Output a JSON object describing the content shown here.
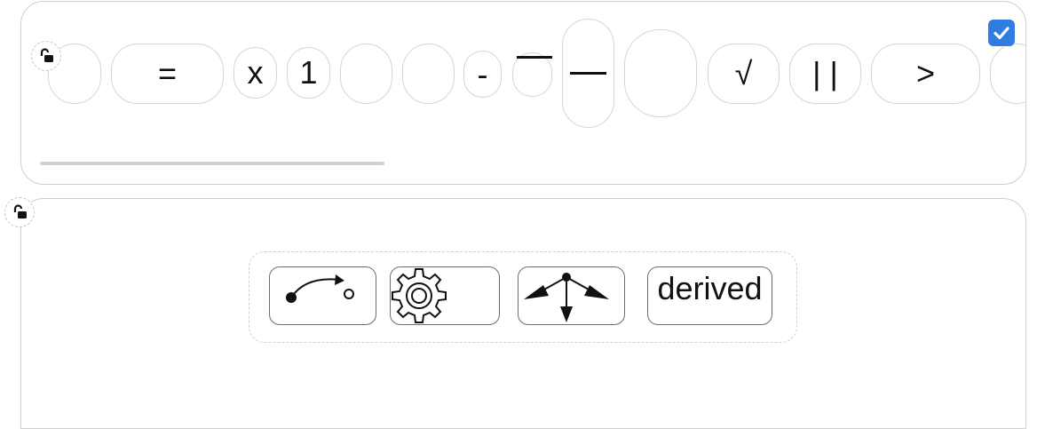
{
  "palette": {
    "tiles": [
      {
        "id": "tile-blank-1",
        "label": ""
      },
      {
        "id": "tile-equals",
        "label": "="
      },
      {
        "id": "tile-variable-x",
        "label": "x"
      },
      {
        "id": "tile-number-1",
        "label": "1"
      },
      {
        "id": "tile-blank-2",
        "label": ""
      },
      {
        "id": "tile-blank-3",
        "label": ""
      },
      {
        "id": "tile-minus",
        "label": "-"
      },
      {
        "id": "tile-overline",
        "label": ""
      },
      {
        "id": "tile-fraction",
        "label": ""
      },
      {
        "id": "tile-blank-4",
        "label": ""
      },
      {
        "id": "tile-sqrt",
        "label": "√"
      },
      {
        "id": "tile-abs",
        "label": "|   |"
      },
      {
        "id": "tile-greater-than",
        "label": ">"
      },
      {
        "id": "tile-blank-5",
        "label": ""
      }
    ],
    "checkbox_checked": true
  },
  "tools": {
    "items": [
      {
        "id": "tool-curve-arrow",
        "label": "",
        "icon": "curve-arrow-icon"
      },
      {
        "id": "tool-gear",
        "label": "",
        "icon": "gear-icon"
      },
      {
        "id": "tool-split-arrows",
        "label": "",
        "icon": "split-arrows-icon"
      },
      {
        "id": "tool-derived",
        "label": "derived",
        "icon": ""
      }
    ]
  },
  "colors": {
    "accent": "#2f7de1",
    "border": "#d6d6d6",
    "tool_border": "#6e6e6e"
  }
}
